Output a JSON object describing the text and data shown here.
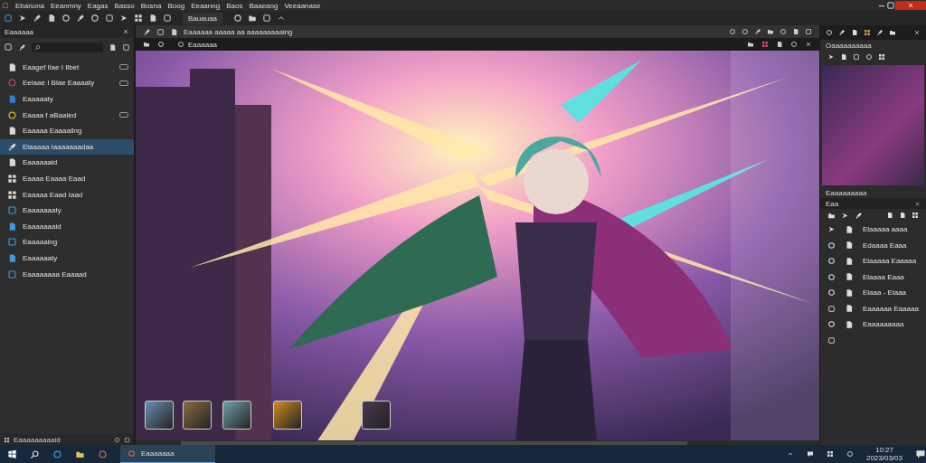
{
  "menu": [
    "Ebanona",
    "Eeanmny",
    "Eagas",
    "Basso",
    "Bosna",
    "Boog",
    "Eeaanng",
    "Baos",
    "Baaeang",
    "Veeaanase"
  ],
  "toolbar": {
    "label": "Bauauaa"
  },
  "left_panel": {
    "title": "Eaaaaaa",
    "items": [
      {
        "label": "Eaagef Ilae I Ilbet",
        "selected": false,
        "badge": true
      },
      {
        "label": "Eeiaae I Blae Eaaaaty",
        "selected": false,
        "badge": true
      },
      {
        "label": "Eaaaaaty",
        "selected": false,
        "badge": false
      },
      {
        "label": "Eaaaa f aBaaled",
        "selected": false,
        "badge": true
      },
      {
        "label": "Eaaaaa Eaaaailng",
        "selected": false,
        "badge": false
      },
      {
        "label": "Eiaaaaa Iaaaaaaadaa",
        "selected": true,
        "badge": false
      },
      {
        "label": "Eaaaaaaid",
        "selected": false,
        "badge": false
      },
      {
        "label": "Eaaaa Eaaaa Eaad",
        "selected": false,
        "badge": false
      },
      {
        "label": "Eaaaaa Eaad Iaad",
        "selected": false,
        "badge": false
      },
      {
        "label": "Eaaaaaaaty",
        "selected": false,
        "badge": false
      },
      {
        "label": "Eaaaaaaaid",
        "selected": false,
        "badge": false
      },
      {
        "label": "Eaaaaaing",
        "selected": false,
        "badge": false
      },
      {
        "label": "Eaaaaaaty",
        "selected": false,
        "badge": false
      },
      {
        "label": "Eaaaaaaaa Eaaaad",
        "selected": false,
        "badge": false
      }
    ],
    "footer": "Eaaaaaaaaaid"
  },
  "document": {
    "options": "Eaaaaaa aaaaa aa aaaaaaaaaing",
    "tab": "Eaaaaaa"
  },
  "right_panel": {
    "header": "Oaaaaaaaaaa",
    "navigator": "Eaaaaaaaaa",
    "panel_title": "Eaa",
    "items": [
      "Elaaaaa aaaa",
      "Edaaaa Eaaa",
      "Elaaaaa Eaaaaa",
      "Elaaaa Eaaa",
      "Elaaa - Elaaa",
      "Eaaaaaa Eaaaaa",
      "Eaaaaaaaaa"
    ]
  },
  "taskbar": {
    "active_app": "Eaaaaaaa",
    "time": "10:27",
    "date": "2023/03/03"
  }
}
